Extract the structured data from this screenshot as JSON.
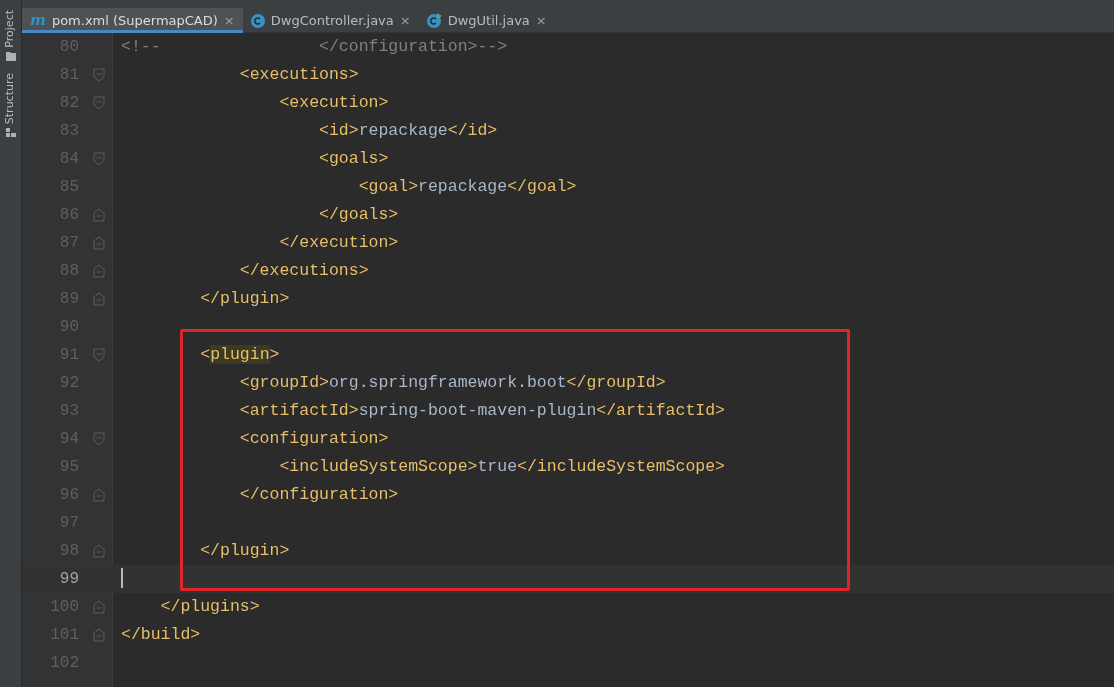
{
  "tool_strip": [
    {
      "label": "Project",
      "kind": "folder"
    },
    {
      "label": "Structure",
      "kind": "structure"
    }
  ],
  "tabs": [
    {
      "label": "pom.xml (SupermapCAD)",
      "kind": "maven",
      "icon_letter": "m",
      "close": "×",
      "selected": true
    },
    {
      "label": "DwgController.java",
      "kind": "class",
      "close": "×",
      "selected": false
    },
    {
      "label": "DwgUtil.java",
      "kind": "class-runnable",
      "close": "×",
      "selected": false
    }
  ],
  "editor": {
    "lines": [
      {
        "number": "80",
        "segments": [
          {
            "kind": "comment",
            "text": "<!--                </configuration>-->"
          }
        ],
        "kind": "plain"
      },
      {
        "number": "81",
        "segments": [
          {
            "kind": "tag",
            "text": "            <executions>"
          }
        ],
        "kind": "fold-start"
      },
      {
        "number": "82",
        "segments": [
          {
            "kind": "tag",
            "text": "                <execution>"
          }
        ],
        "kind": "fold-start"
      },
      {
        "number": "83",
        "segments": [
          {
            "kind": "tag",
            "text": "                    <id>"
          },
          {
            "kind": "text",
            "text": "repackage"
          },
          {
            "kind": "tag",
            "text": "</id>"
          }
        ],
        "kind": "plain"
      },
      {
        "number": "84",
        "segments": [
          {
            "kind": "tag",
            "text": "                    <goals>"
          }
        ],
        "kind": "fold-start"
      },
      {
        "number": "85",
        "segments": [
          {
            "kind": "tag",
            "text": "                        <goal>"
          },
          {
            "kind": "text",
            "text": "repackage"
          },
          {
            "kind": "tag",
            "text": "</goal>"
          }
        ],
        "kind": "plain"
      },
      {
        "number": "86",
        "segments": [
          {
            "kind": "tag",
            "text": "                    </goals>"
          }
        ],
        "kind": "fold-end"
      },
      {
        "number": "87",
        "segments": [
          {
            "kind": "tag",
            "text": "                </execution>"
          }
        ],
        "kind": "fold-end"
      },
      {
        "number": "88",
        "segments": [
          {
            "kind": "tag",
            "text": "            </executions>"
          }
        ],
        "kind": "fold-end"
      },
      {
        "number": "89",
        "segments": [
          {
            "kind": "tag",
            "text": "        </plugin>"
          }
        ],
        "kind": "fold-end"
      },
      {
        "number": "90",
        "kind": "plain"
      }
    ],
    "annotation": {
      "color": "#e0242b",
      "lines": [
        {
          "number": "91",
          "segments": [
            {
              "kind": "tag",
              "text": "        <"
            },
            {
              "kind": "tag-match",
              "text": "plugin"
            },
            {
              "kind": "tag",
              "text": ">"
            }
          ],
          "kind": "fold-start"
        },
        {
          "number": "92",
          "segments": [
            {
              "kind": "tag",
              "text": "            <groupId>"
            },
            {
              "kind": "text",
              "text": "org.springframework.boot"
            },
            {
              "kind": "tag",
              "text": "</groupId>"
            }
          ],
          "kind": "plain"
        },
        {
          "number": "93",
          "segments": [
            {
              "kind": "tag",
              "text": "            <artifactId>"
            },
            {
              "kind": "text",
              "text": "spring-boot-maven-plugin"
            },
            {
              "kind": "tag",
              "text": "</artifactId>"
            }
          ],
          "kind": "plain"
        },
        {
          "number": "94",
          "segments": [
            {
              "kind": "tag",
              "text": "            <configuration>"
            }
          ],
          "kind": "fold-start"
        },
        {
          "number": "95",
          "segments": [
            {
              "kind": "tag",
              "text": "                <includeSystemScope>"
            },
            {
              "kind": "text",
              "text": "true"
            },
            {
              "kind": "tag",
              "text": "</includeSystemScope>"
            }
          ],
          "kind": "plain"
        },
        {
          "number": "96",
          "segments": [
            {
              "kind": "tag",
              "text": "            </configuration>"
            }
          ],
          "kind": "fold-end"
        },
        {
          "number": "97",
          "kind": "plain"
        },
        {
          "number": "98",
          "segments": [
            {
              "kind": "tag",
              "text": "        </plugin>"
            }
          ],
          "kind": "fold-end"
        },
        {
          "number": "99",
          "kind": "plain",
          "current": true
        }
      ]
    },
    "lines_after": [
      {
        "number": "100",
        "segments": [
          {
            "kind": "tag",
            "text": "    </plugins>"
          }
        ],
        "kind": "fold-end"
      },
      {
        "number": "101",
        "segments": [
          {
            "kind": "tag",
            "text": "</build>"
          }
        ],
        "kind": "fold-end"
      },
      {
        "number": "102",
        "kind": "plain"
      }
    ]
  }
}
